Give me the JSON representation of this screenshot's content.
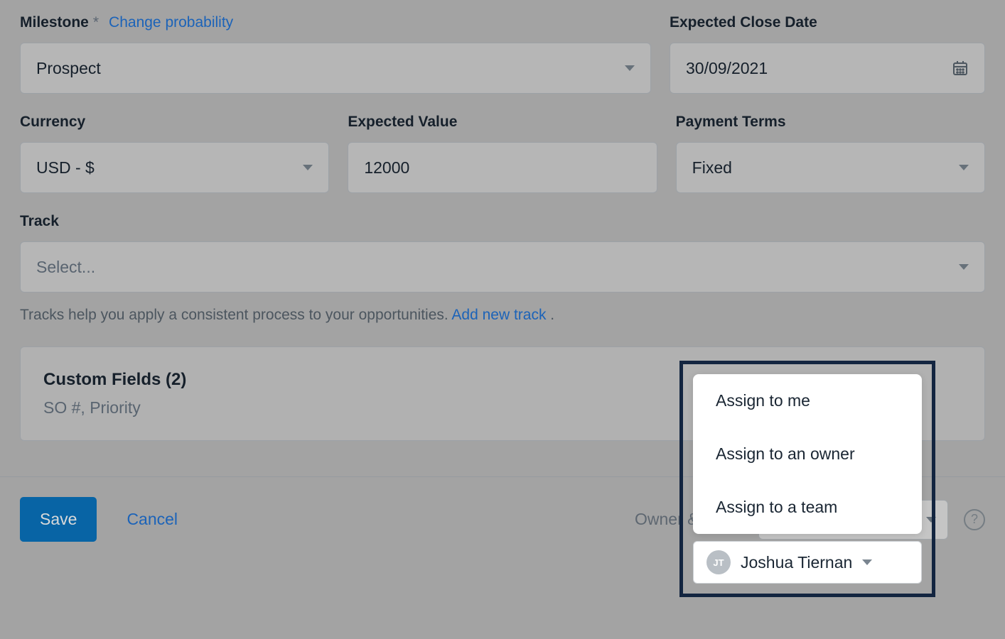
{
  "fields": {
    "milestone": {
      "label": "Milestone",
      "required": "*",
      "change_link": "Change probability",
      "value": "Prospect"
    },
    "close_date": {
      "label": "Expected Close Date",
      "value": "30/09/2021"
    },
    "currency": {
      "label": "Currency",
      "value": "USD - $"
    },
    "expected_value": {
      "label": "Expected Value",
      "value": "12000"
    },
    "payment_terms": {
      "label": "Payment Terms",
      "value": "Fixed"
    },
    "track": {
      "label": "Track",
      "placeholder": "Select...",
      "helper": "Tracks help you apply a consistent process to your opportunities. ",
      "add_link": "Add new track",
      "dot": " ."
    }
  },
  "custom_fields": {
    "title": "Custom Fields (2)",
    "subtitle": "SO #, Priority"
  },
  "footer": {
    "save": "Save",
    "cancel": "Cancel",
    "owner_label": "Owner & Team",
    "owner": {
      "initials": "JT",
      "name": "Joshua Tiernan"
    },
    "help": "?"
  },
  "popover": {
    "items": [
      "Assign to me",
      "Assign to an owner",
      "Assign to a team"
    ]
  }
}
